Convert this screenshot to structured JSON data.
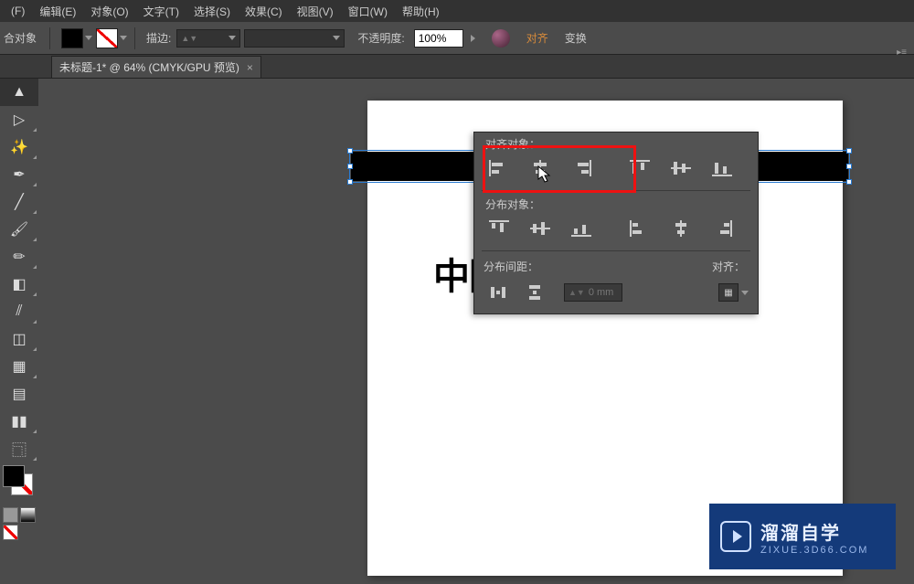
{
  "menu": {
    "file": "(F)",
    "edit": "编辑(E)",
    "object": "对象(O)",
    "type": "文字(T)",
    "select": "选择(S)",
    "effect": "效果(C)",
    "view": "视图(V)",
    "window": "窗口(W)",
    "help": "帮助(H)"
  },
  "controlbar": {
    "target": "合对象",
    "stroke_label": "描边:",
    "stroke_value": "",
    "opacity_label": "不透明度:",
    "opacity_value": "100%",
    "align_link": "对齐",
    "transform_link": "变换"
  },
  "tab": {
    "title": "未标题-1* @ 64% (CMYK/GPU 预览)"
  },
  "align_panel": {
    "section_align": "对齐对象：",
    "section_distribute": "分布对象：",
    "section_spacing": "分布间距：",
    "spacing_value": "0 mm",
    "align_to_label": "对齐：",
    "btn_align_left": "左对齐",
    "btn_align_hcenter": "水平居中对齐",
    "btn_align_right": "右对齐",
    "btn_align_top": "顶对齐",
    "btn_align_vcenter": "垂直居中对齐",
    "btn_align_bottom": "底对齐",
    "btn_dist_top": "顶部分布",
    "btn_dist_vcenter": "垂直居中分布",
    "btn_dist_bottom": "底部分布",
    "btn_dist_left": "左侧分布",
    "btn_dist_hcenter": "水平居中分布",
    "btn_dist_right": "右侧分布"
  },
  "canvas": {
    "artwork_text": "中国好歌曲"
  },
  "watermark": {
    "title": "溜溜自学",
    "sub": "ZIXUE.3D66.COM"
  }
}
